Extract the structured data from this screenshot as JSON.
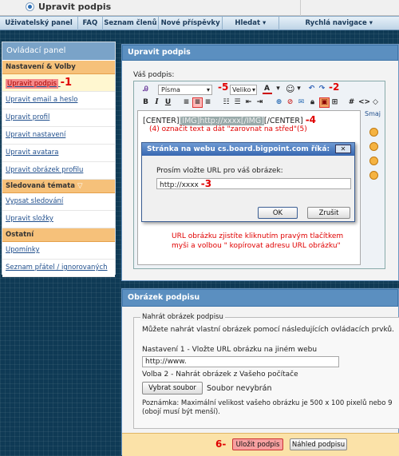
{
  "window": {
    "title": "Upravit podpis"
  },
  "nav": {
    "items": [
      "Uživatelský panel",
      "FAQ",
      "Seznam členů",
      "Nové příspěvky",
      "Hledat",
      "Rychlá navigace"
    ]
  },
  "sidebar": {
    "header": "Ovládací panel",
    "sections": [
      {
        "title": "Nastavení & Volby",
        "items": [
          "Upravit podpis",
          "Upravit email a heslo",
          "Upravit profil",
          "Upravit nastavení",
          "Upravit avatara",
          "Upravit obrázek profilu"
        ]
      },
      {
        "title": "Sledovaná témata",
        "items": [
          "Vypsat sledování",
          "Upravit složky"
        ]
      },
      {
        "title": "Ostatní",
        "items": [
          "Upomínky",
          "Seznam přátel / ignorovaných"
        ]
      }
    ]
  },
  "editor": {
    "panel_title": "Upravit podpis",
    "label": "Váš podpis:",
    "font_select": "Písma",
    "size_select": "Veliko",
    "content_line1_a": "[CENTER]",
    "content_line1_b": "[IMG]http://xxxx[/IMG]",
    "content_line1_c": "[/CENTER]",
    "smilies_title": "Smaj"
  },
  "dialog": {
    "title": "Stránka na webu cs.board.bigpoint.com říká:",
    "prompt": "Prosím vložte URL pro váš obrázek:",
    "value": "http://xxxx",
    "ok": "OK",
    "cancel": "Zrušit"
  },
  "annotations": {
    "n1": "-1",
    "n2": "-2",
    "n3": "-3",
    "n4": "-4",
    "n5": "-5",
    "n6": "6-",
    "step4": "(4) označit text a dát \"zarovnat na střed\"(5)",
    "url_note1": "URL  obrázku zjistíte kliknutím pravým tlačítkem",
    "url_note2": "myši a volbou \" kopírovat adresu URL obrázku\""
  },
  "image_panel": {
    "title": "Obrázek podpisu",
    "fieldset": "Nahrát obrázek podpisu",
    "desc": "Můžete nahrát vlastní obrázek pomocí následujících ovládacích prvků.",
    "option1": "Nastavení 1 - Vložte URL obrázku na jiném webu",
    "url_value": "http://www.",
    "option2": "Volba 2 - Nahrát obrázek z Vašeho počítače",
    "choose_button": "Vybrat soubor",
    "no_file": "Soubor nevybrán",
    "note1": "Poznámka: Maximální velikost vašeho obrázku je 500 x 100 pixelů nebo 9",
    "note2": "(obojí musí být menší)."
  },
  "buttons": {
    "save": "Uložit podpis",
    "preview": "Náhled podpisu"
  },
  "colors": {
    "accent": "#5b8fc0",
    "annotation": "#e00000",
    "section": "#f6c17a"
  }
}
